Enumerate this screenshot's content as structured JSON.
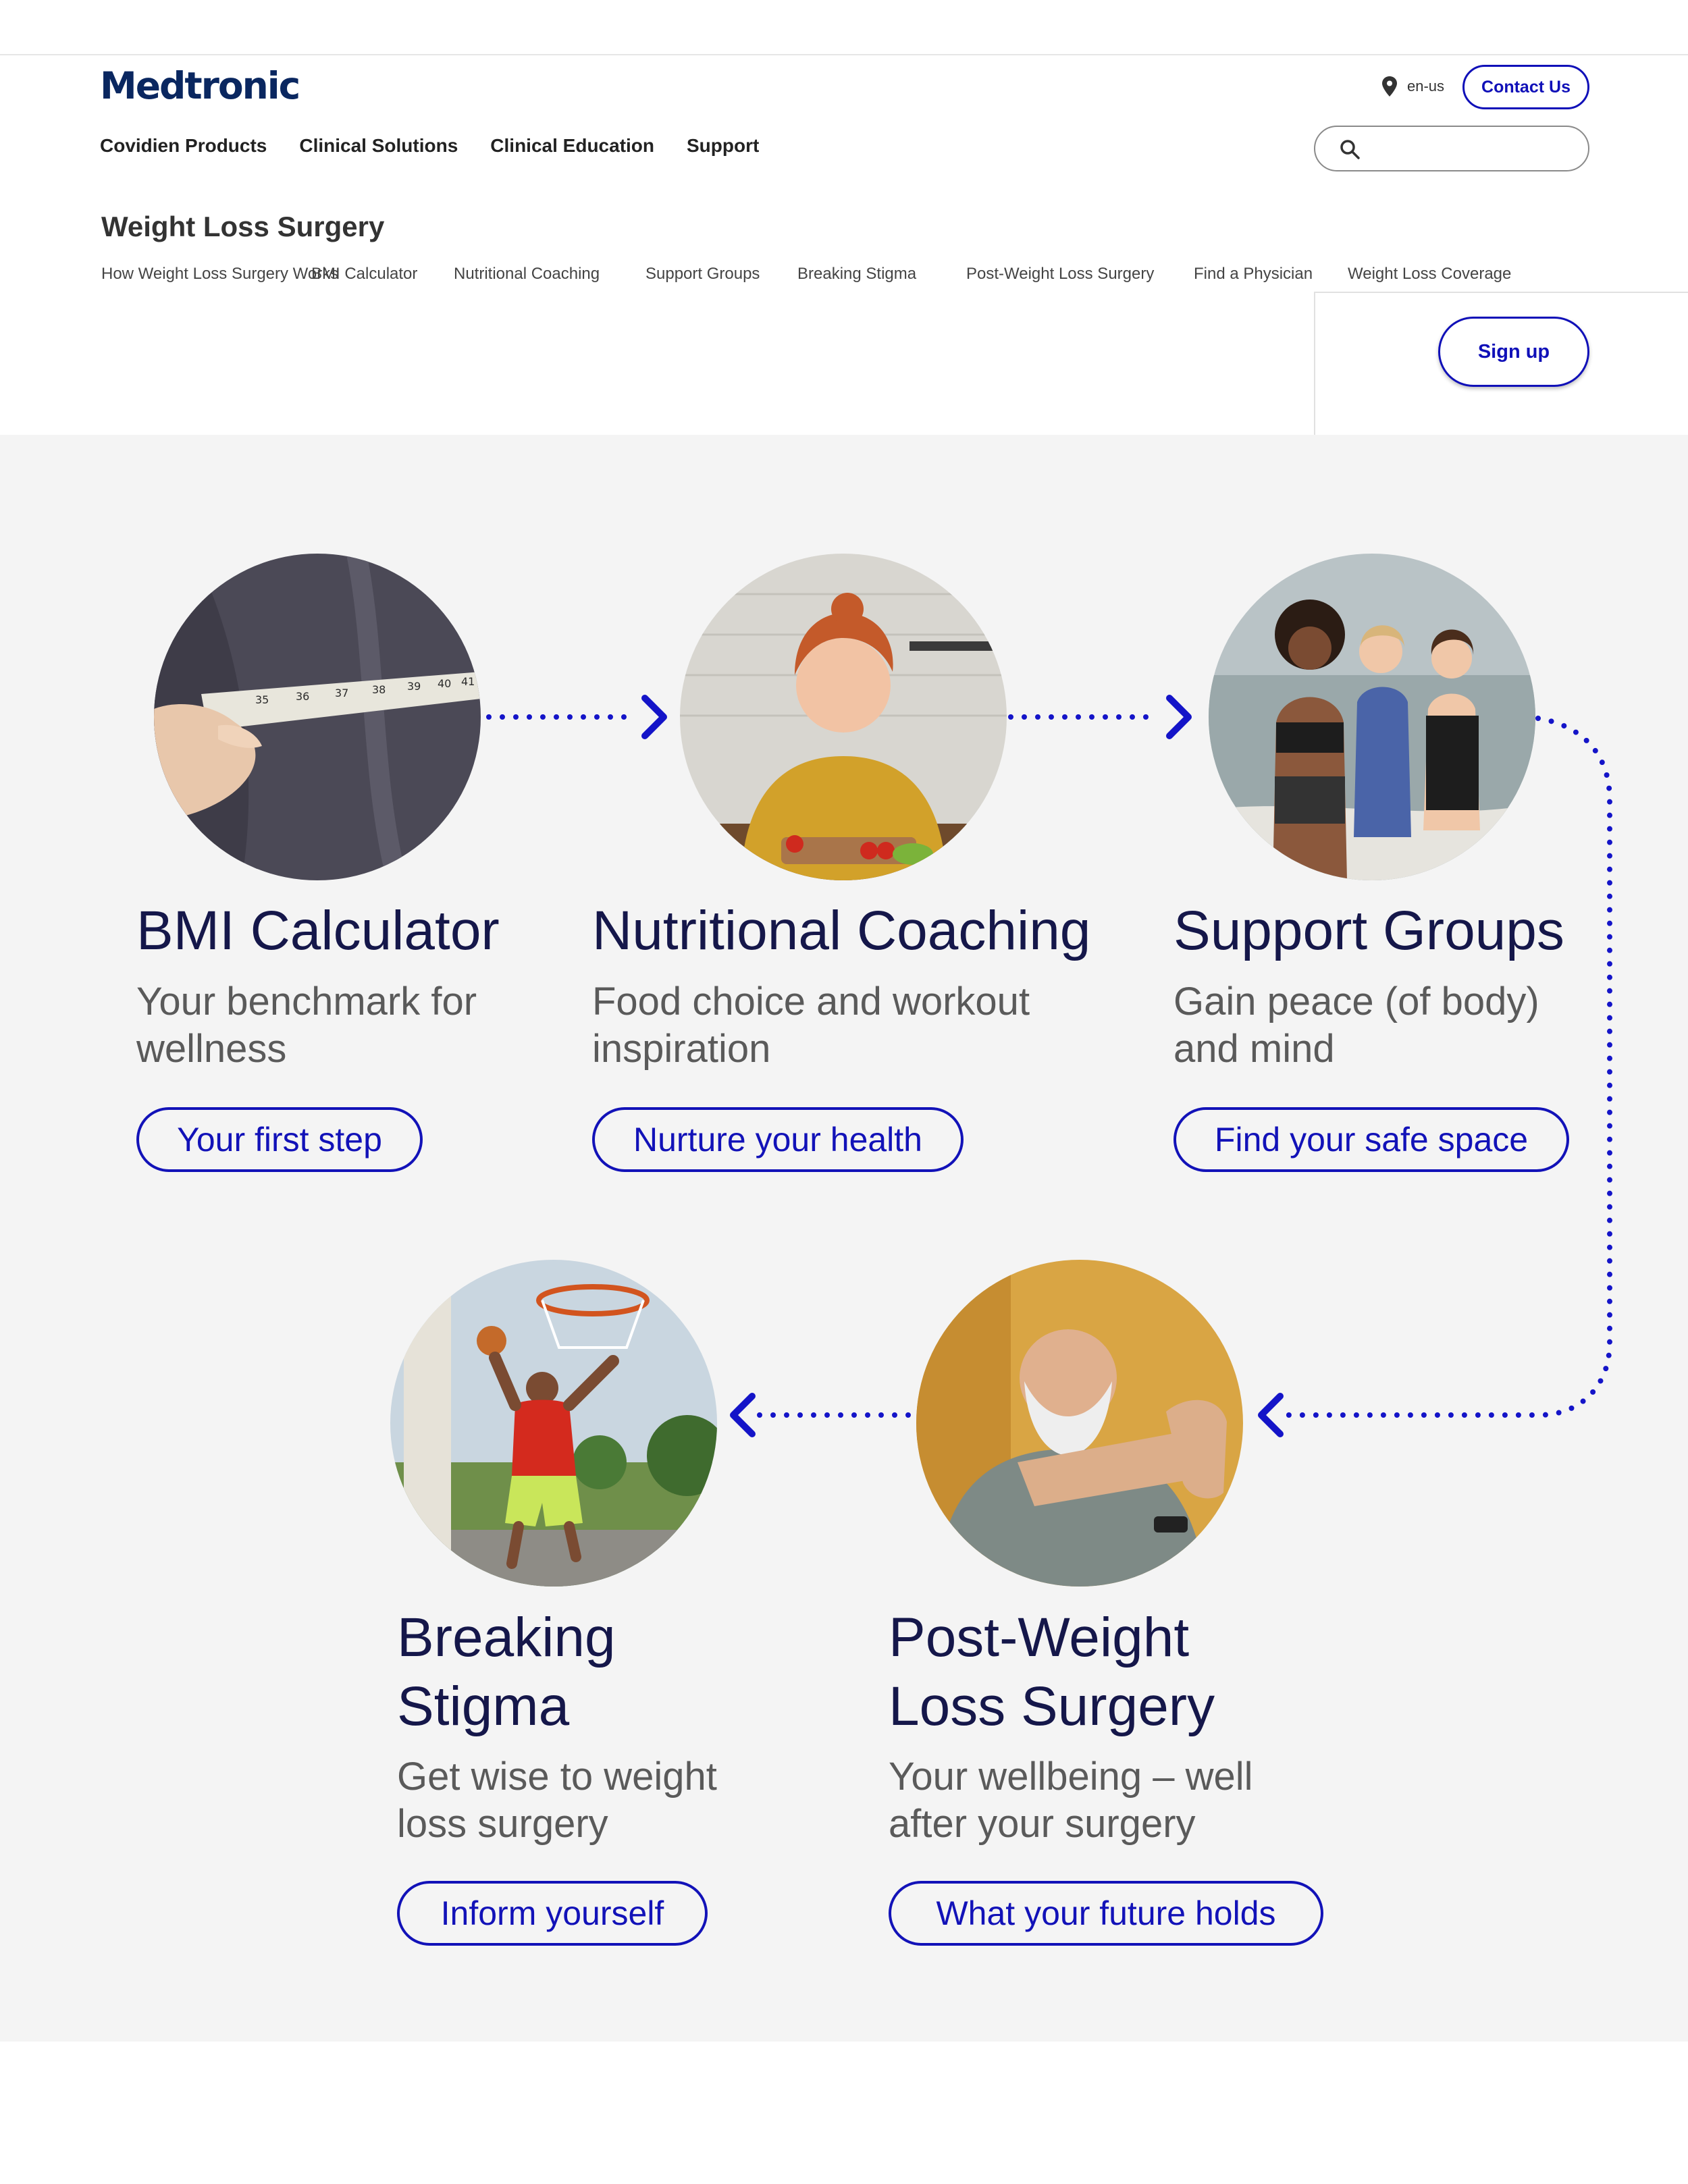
{
  "header": {
    "logo": "Medtronic",
    "locale": "en-us",
    "contact_label": "Contact Us",
    "nav": [
      "Covidien Products",
      "Clinical Solutions",
      "Clinical Education",
      "Support"
    ],
    "search_placeholder": ""
  },
  "section": {
    "title": "Weight Loss Surgery",
    "subnav": [
      "How Weight Loss Surgery Works",
      "BMI Calculator",
      "Nutritional Coaching",
      "Support Groups",
      "Breaking Stigma",
      "Post-Weight Loss Surgery",
      "Find a Physician",
      "Weight Loss Coverage"
    ],
    "signup_label": "Sign up"
  },
  "cards": [
    {
      "title": "BMI Calculator",
      "desc_line1": "Your benchmark for",
      "desc_line2": "wellness",
      "button": "Your first step"
    },
    {
      "title": "Nutritional Coaching",
      "desc_line1": "Food choice and workout",
      "desc_line2": "inspiration",
      "button": "Nurture your health"
    },
    {
      "title": "Support Groups",
      "desc_line1": "Gain peace (of body)",
      "desc_line2": "and mind",
      "button": "Find your safe space"
    },
    {
      "title_line1": "Breaking",
      "title_line2": "Stigma",
      "desc_line1": "Get wise to weight",
      "desc_line2": "loss surgery",
      "button": "Inform yourself"
    },
    {
      "title_line1": "Post-Weight",
      "title_line2": "Loss Surgery",
      "desc_line1": "Your wellbeing – well",
      "desc_line2": "after your surgery",
      "button": "What your future holds"
    }
  ],
  "tape_numbers": [
    "35",
    "36",
    "37",
    "38",
    "39",
    "40",
    "41"
  ],
  "colors": {
    "accent": "#1212b8",
    "brand": "#0a2760",
    "panel_bg": "#f4f4f4",
    "title": "#15174a"
  }
}
